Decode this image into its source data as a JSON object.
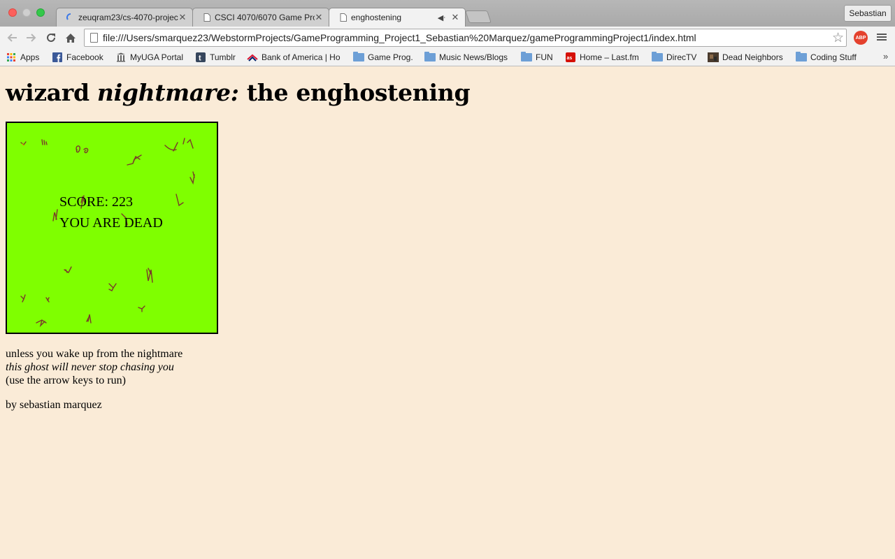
{
  "window": {
    "profile_name": "Sebastian"
  },
  "tabs": [
    {
      "title": "zeuqram23/cs-4070-projec",
      "icon": "github-loading-icon",
      "active": false
    },
    {
      "title": "CSCI 4070/6070 Game Pro",
      "icon": "page-icon",
      "active": false
    },
    {
      "title": "enghostening",
      "icon": "page-icon",
      "active": true,
      "audio": true
    }
  ],
  "toolbar": {
    "url": "file:///Users/smarquez23/WebstormProjects/GameProgramming_Project1_Sebastian%20Marquez/gameProgrammingProject1/index.html",
    "extension_label": "ABP"
  },
  "bookmarks": [
    {
      "label": "Apps",
      "icon": "apps-grid-icon"
    },
    {
      "label": "Facebook",
      "icon": "facebook-icon"
    },
    {
      "label": "MyUGA Portal",
      "icon": "building-icon"
    },
    {
      "label": "Tumblr",
      "icon": "tumblr-icon"
    },
    {
      "label": "Bank of America | Ho",
      "icon": "bank-flag-icon"
    },
    {
      "label": "Game Prog.",
      "icon": "folder-icon"
    },
    {
      "label": "Music News/Blogs",
      "icon": "folder-icon"
    },
    {
      "label": "FUN",
      "icon": "folder-icon"
    },
    {
      "label": "Home – Last.fm",
      "icon": "lastfm-icon"
    },
    {
      "label": "DirecTV",
      "icon": "folder-icon"
    },
    {
      "label": "Dead Neighbors",
      "icon": "thumbnail-icon"
    },
    {
      "label": "Coding Stuff",
      "icon": "folder-icon"
    }
  ],
  "page": {
    "title_part1": "wizard ",
    "title_part2": "nightmare:",
    "title_part3": " the enghostening",
    "game": {
      "score_text": "SCORE: 223",
      "status_text": "YOU ARE DEAD",
      "background_color": "#7fff00"
    },
    "line1": "unless you wake up from the nightmare",
    "line2": "this ghost will never stop chasing you",
    "line3": "(use the arrow keys to run)",
    "byline": "by sebastian marquez"
  }
}
